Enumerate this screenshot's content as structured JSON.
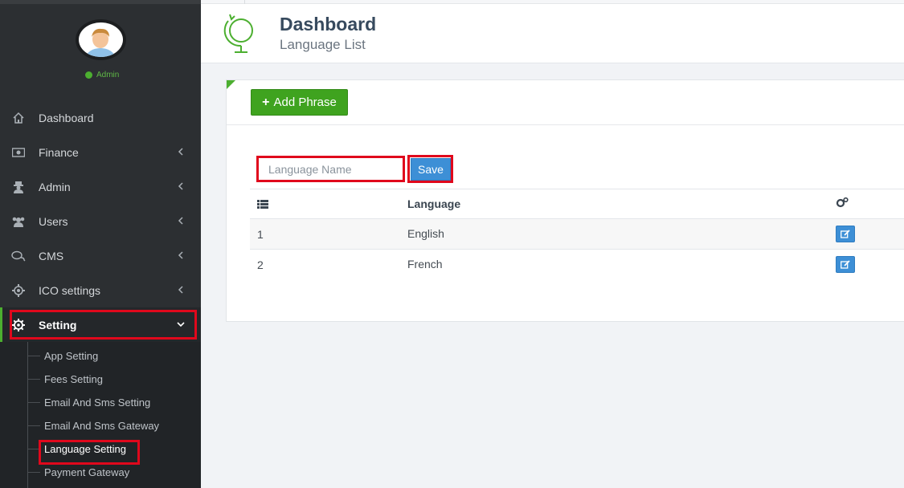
{
  "user": {
    "role": "Admin"
  },
  "sidebar": {
    "items": [
      {
        "label": "Dashboard",
        "icon": "home-icon"
      },
      {
        "label": "Finance",
        "icon": "money-icon"
      },
      {
        "label": "Admin",
        "icon": "user-secret-icon"
      },
      {
        "label": "Users",
        "icon": "users-icon"
      },
      {
        "label": "CMS",
        "icon": "comments-icon"
      },
      {
        "label": "ICO settings",
        "icon": "cog-outline-icon"
      },
      {
        "label": "Setting",
        "icon": "gear-icon"
      }
    ],
    "submenu": [
      {
        "label": "App Setting"
      },
      {
        "label": "Fees Setting"
      },
      {
        "label": "Email And Sms Setting"
      },
      {
        "label": "Email And Sms Gateway"
      },
      {
        "label": "Language Setting"
      },
      {
        "label": "Payment Gateway"
      }
    ]
  },
  "header": {
    "title": "Dashboard",
    "subtitle": "Language List",
    "icon": "globe-icon"
  },
  "panel": {
    "add_button": "Add Phrase",
    "language_input": {
      "placeholder": "Language Name",
      "value": ""
    },
    "save_button": "Save",
    "table": {
      "headers": [
        "",
        "Language",
        ""
      ],
      "header_icons": [
        "list-icon",
        "",
        "cogs-icon"
      ],
      "rows": [
        {
          "id": "1",
          "language": "English",
          "action_icon": "edit-icon"
        },
        {
          "id": "2",
          "language": "French",
          "action_icon": "edit-icon"
        }
      ]
    }
  },
  "colors": {
    "accent_green": "#4caf30",
    "button_blue": "#3d8fd6",
    "highlight_red": "#e0081c",
    "sidebar_bg": "#2c2f32"
  }
}
